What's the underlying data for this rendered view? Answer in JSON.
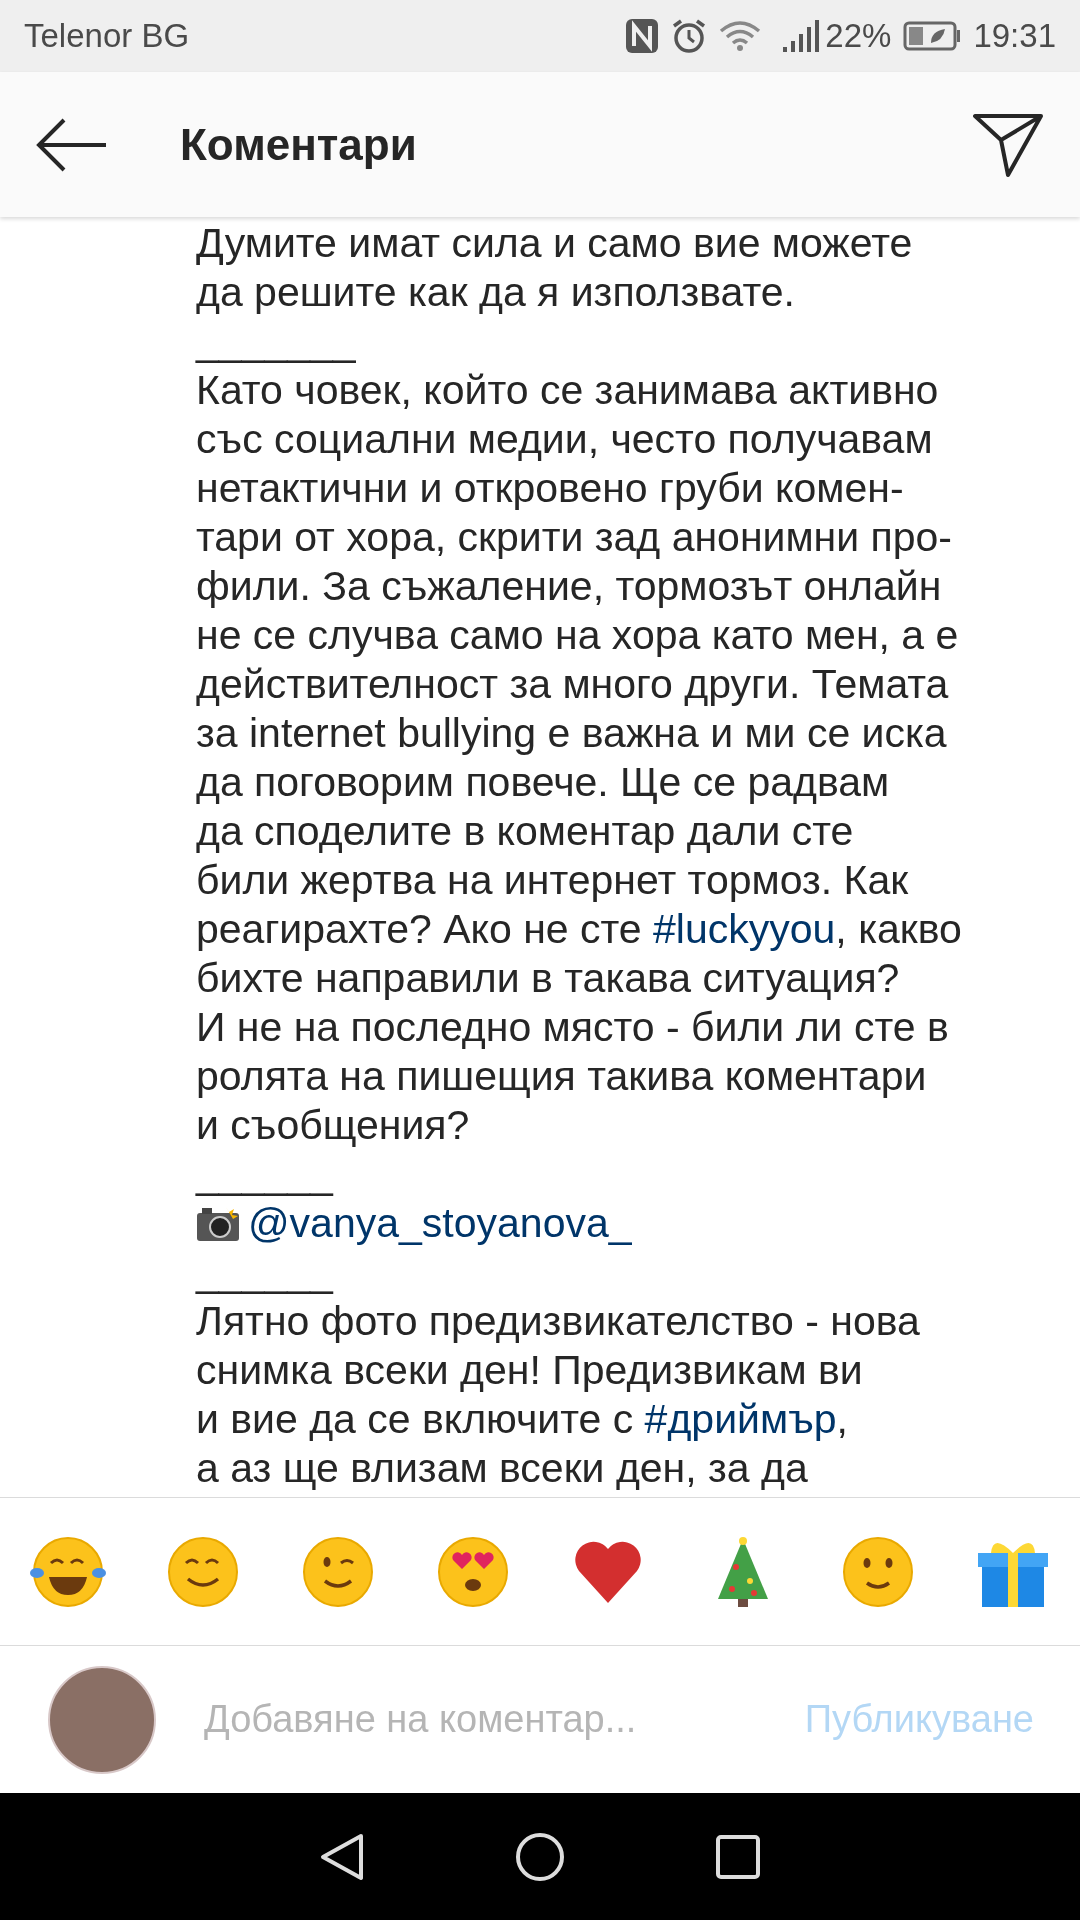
{
  "status_bar": {
    "carrier": "Telenor BG",
    "battery_percent": "22%",
    "time": "19:31"
  },
  "header": {
    "title": "Коментари"
  },
  "caption_lines": [
    {
      "parts": [
        {
          "kind": "text",
          "text": "Думите имат сила и само вие можете"
        }
      ]
    },
    {
      "parts": [
        {
          "kind": "text",
          "text": "да решите как да я използвате."
        }
      ]
    },
    {
      "parts": [
        {
          "kind": "text",
          "text": "_______"
        }
      ]
    },
    {
      "parts": [
        {
          "kind": "text",
          "text": "Като човек, който се занимава активно"
        }
      ]
    },
    {
      "parts": [
        {
          "kind": "text",
          "text": "със социални медии, често получавам"
        }
      ]
    },
    {
      "parts": [
        {
          "kind": "text",
          "text": "нетактични и откровено груби комен-"
        }
      ]
    },
    {
      "parts": [
        {
          "kind": "text",
          "text": "тари от хора, скрити зад анонимни про-"
        }
      ]
    },
    {
      "parts": [
        {
          "kind": "text",
          "text": "фили. За съжаление, тормозът онлайн"
        }
      ]
    },
    {
      "parts": [
        {
          "kind": "text",
          "text": "не се случва само на хора като мен, а е"
        }
      ]
    },
    {
      "parts": [
        {
          "kind": "text",
          "text": "действителност за много други. Темата"
        }
      ]
    },
    {
      "parts": [
        {
          "kind": "text",
          "text": "за internet bullying е важна и ми се иска"
        }
      ]
    },
    {
      "parts": [
        {
          "kind": "text",
          "text": "да поговорим повече. Ще се радвам"
        }
      ]
    },
    {
      "parts": [
        {
          "kind": "text",
          "text": "да споделите в коментар дали сте"
        }
      ]
    },
    {
      "parts": [
        {
          "kind": "text",
          "text": "били жертва на интернет тормоз. Как"
        }
      ]
    },
    {
      "parts": [
        {
          "kind": "text",
          "text": "реагирахте? Ако не сте "
        },
        {
          "kind": "tag",
          "text": "#luckyyou"
        },
        {
          "kind": "text",
          "text": ", какво"
        }
      ]
    },
    {
      "parts": [
        {
          "kind": "text",
          "text": "бихте направили в такава ситуация?"
        }
      ]
    },
    {
      "parts": [
        {
          "kind": "text",
          "text": "И не на последно място - били ли сте в"
        }
      ]
    },
    {
      "parts": [
        {
          "kind": "text",
          "text": "ролята на пишещия такива коментари"
        }
      ]
    },
    {
      "parts": [
        {
          "kind": "text",
          "text": "и съобщения?"
        }
      ]
    },
    {
      "parts": [
        {
          "kind": "text",
          "text": "______"
        }
      ]
    },
    {
      "parts": [
        {
          "kind": "camera"
        },
        {
          "kind": "tag",
          "text": "@vanya_stoyanova_"
        }
      ]
    },
    {
      "parts": [
        {
          "kind": "text",
          "text": "______"
        }
      ]
    },
    {
      "parts": [
        {
          "kind": "text",
          "text": "Лятно фото предизвикателство - нова"
        }
      ]
    },
    {
      "parts": [
        {
          "kind": "text",
          "text": "снимка всеки ден! Предизвикам ви"
        }
      ]
    },
    {
      "parts": [
        {
          "kind": "text",
          "text": "и вие да се включите с "
        },
        {
          "kind": "tag",
          "text": "#дриймър"
        },
        {
          "kind": "text",
          "text": ","
        }
      ]
    },
    {
      "parts": [
        {
          "kind": "text",
          "text": "а аз ще влизам всеки ден, за да"
        }
      ]
    }
  ],
  "emoji_bar": [
    {
      "kind": "laugh"
    },
    {
      "kind": "smile"
    },
    {
      "kind": "wink"
    },
    {
      "kind": "hearteyes"
    },
    {
      "kind": "heart"
    },
    {
      "kind": "tree"
    },
    {
      "kind": "slight"
    },
    {
      "kind": "gift"
    }
  ],
  "comment_box": {
    "placeholder": "Добавяне на коментар...",
    "post_button": {
      "label": "Публикуване",
      "disabled": true
    }
  }
}
